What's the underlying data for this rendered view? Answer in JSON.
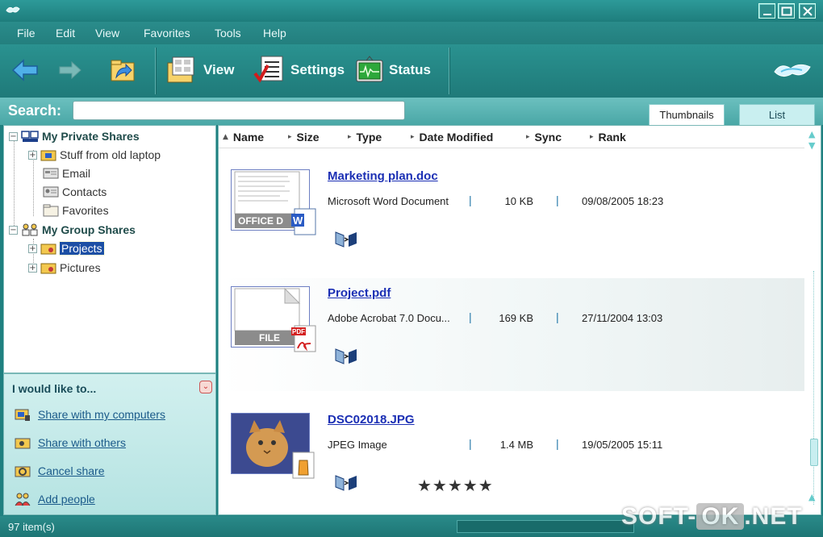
{
  "menu": [
    "File",
    "Edit",
    "View",
    "Favorites",
    "Tools",
    "Help"
  ],
  "toolbar": {
    "view_label": "View",
    "settings_label": "Settings",
    "status_label": "Status"
  },
  "search": {
    "label": "Search:",
    "value": "",
    "placeholder": ""
  },
  "view_tabs": {
    "thumbnails": "Thumbnails",
    "list": "List",
    "active": "Thumbnails"
  },
  "tree": {
    "private_shares": "My Private Shares",
    "private_children": [
      "Stuff from old laptop",
      "Email",
      "Contacts",
      "Favorites"
    ],
    "group_shares": "My Group Shares",
    "group_children": [
      "Projects",
      "Pictures"
    ],
    "selected": "Projects"
  },
  "tasks": {
    "title": "I would like to...",
    "links": [
      "Share with my computers",
      "Share with others",
      "Cancel share",
      "Add people"
    ]
  },
  "columns": [
    "Name",
    "Size",
    "Type",
    "Date Modified",
    "Sync",
    "Rank"
  ],
  "files": [
    {
      "name": "Marketing plan.doc",
      "type": "Microsoft Word Document",
      "size": "10 KB",
      "date": "09/08/2005 18:23",
      "thumb_label": "OFFICE D",
      "icon": "word-doc-icon",
      "rank": ""
    },
    {
      "name": "Project.pdf",
      "type": "Adobe Acrobat 7.0 Docu...",
      "size": "169 KB",
      "date": "27/11/2004 13:03",
      "thumb_label": "FILE",
      "icon": "pdf-icon",
      "rank": ""
    },
    {
      "name": "DSC02018.JPG",
      "type": "JPEG Image",
      "size": "1.4 MB",
      "date": "19/05/2005 15:11",
      "thumb_label": "",
      "icon": "image-icon",
      "rank": "★★★★★"
    }
  ],
  "status": {
    "item_count": "97 item(s)"
  },
  "watermark": {
    "left": "SOFT-",
    "mid": "OK",
    "right": ".NET"
  },
  "colors": {
    "chrome": "#1f8080",
    "link": "#1b2fb4",
    "selection": "#1c4fa5"
  }
}
